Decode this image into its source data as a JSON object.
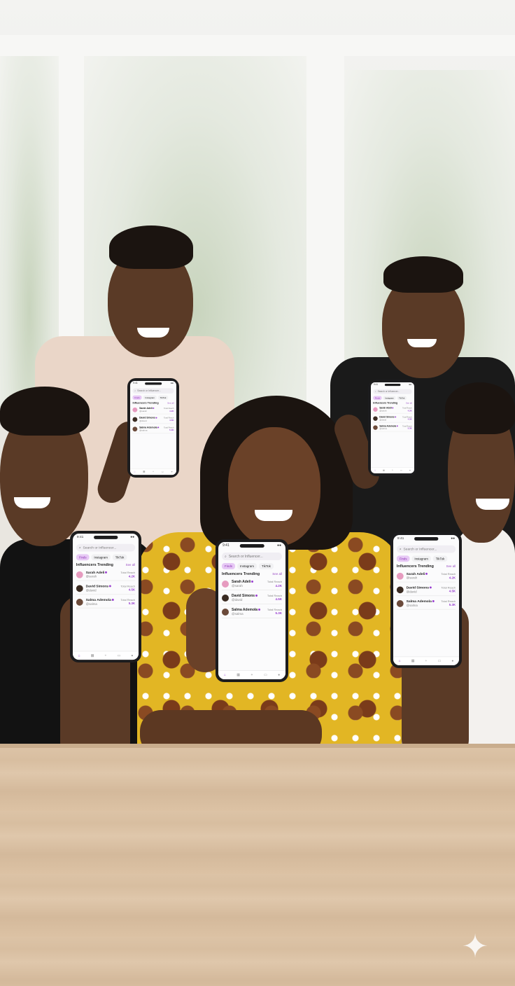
{
  "phone_app": {
    "search_placeholder": "Search or Influencer...",
    "chips": [
      "Finds",
      "Instagram",
      "TikTok"
    ],
    "section_title": "Influencers Trending",
    "see_all": "See all",
    "rows": [
      {
        "name": "Sarah Adeli",
        "handle": "@sarah",
        "stat_label": "Total Reach",
        "stat_value": "4.2K"
      },
      {
        "name": "David Simons",
        "handle": "@david",
        "stat_label": "Total Reach",
        "stat_value": "4.5K"
      },
      {
        "name": "Salma Ademola",
        "handle": "@salma",
        "stat_label": "Total Reach",
        "stat_value": "5.3K"
      }
    ],
    "tabs": [
      "home-icon",
      "grid-icon",
      "plus-icon",
      "chat-icon",
      "person-icon"
    ]
  },
  "colors": {
    "accent": "#9a3fd1",
    "chip_active_bg": "#e7c9f5",
    "table": "#dcc3a6",
    "dress": "#e2b624"
  }
}
